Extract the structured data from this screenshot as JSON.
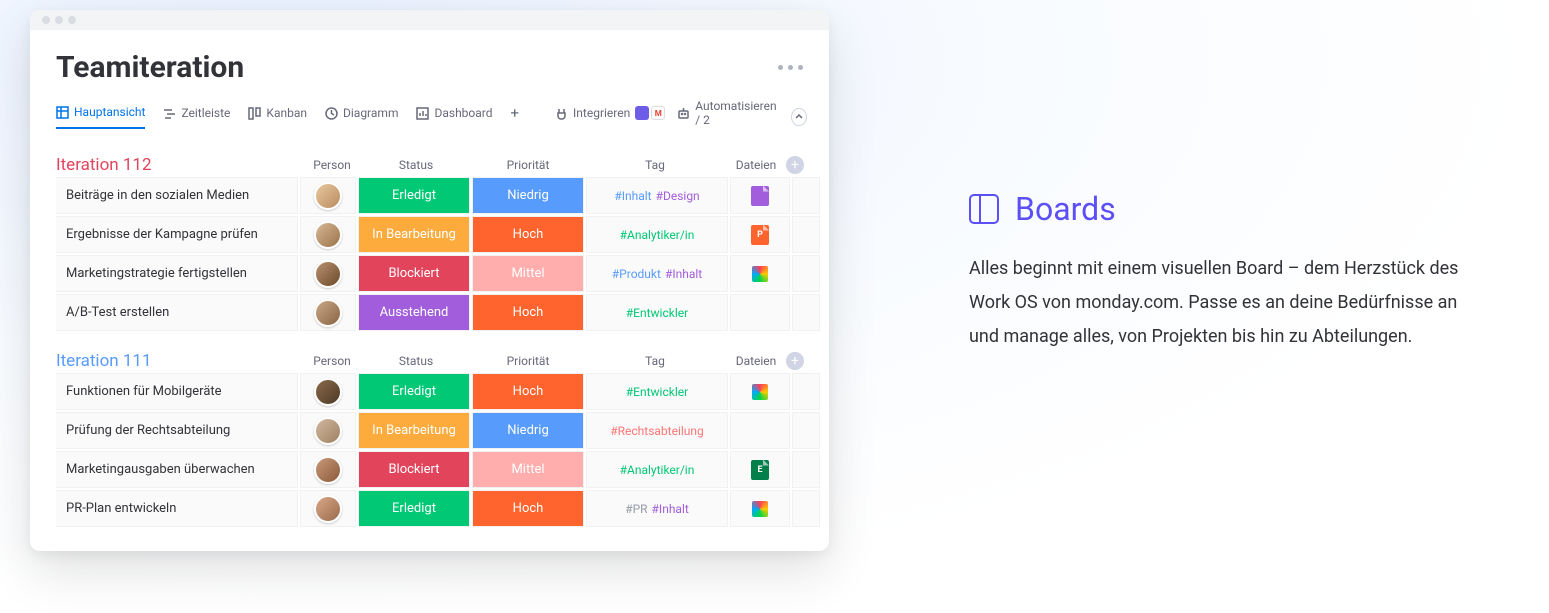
{
  "board": {
    "title": "Teamiteration",
    "tabs": [
      {
        "label": "Hauptansicht"
      },
      {
        "label": "Zeitleiste"
      },
      {
        "label": "Kanban"
      },
      {
        "label": "Diagramm"
      },
      {
        "label": "Dashboard"
      }
    ],
    "tools": {
      "integrate": "Integrieren",
      "automate": "Automatisieren / 2"
    },
    "columns": {
      "person": "Person",
      "status": "Status",
      "priority": "Priorität",
      "tag": "Tag",
      "files": "Dateien"
    },
    "groups": [
      {
        "title": "Iteration 112",
        "rows": [
          {
            "name": "Beiträge in den sozialen Medien",
            "avatar": "linear-gradient(135deg,#e8c8a0,#b98b5e)",
            "status": {
              "label": "Erledigt",
              "bg": "#00c875"
            },
            "priority": {
              "label": "Niedrig",
              "bg": "#579bfc"
            },
            "tags": [
              {
                "t": "#Inhalt",
                "c": "#579bfc"
              },
              {
                "t": "#Design",
                "c": "#a25ddc"
              }
            ],
            "file": {
              "bg": "#a25ddc"
            }
          },
          {
            "name": "Ergebnisse der Kampagne prüfen",
            "avatar": "linear-gradient(135deg,#d8b896,#9a7248)",
            "status": {
              "label": "In Bearbeitung",
              "bg": "#fdab3d"
            },
            "priority": {
              "label": "Hoch",
              "bg": "#ff642e"
            },
            "tags": [
              {
                "t": "#Analytiker/in",
                "c": "#00c875"
              }
            ],
            "file": {
              "bg": "#ff642e",
              "txt": "P"
            }
          },
          {
            "name": "Marketingstrategie fertigstellen",
            "avatar": "linear-gradient(135deg,#b89070,#6d4a2a)",
            "status": {
              "label": "Blockiert",
              "bg": "#e2445c"
            },
            "priority": {
              "label": "Mittel",
              "bg": "#ffadad"
            },
            "tags": [
              {
                "t": "#Produkt",
                "c": "#579bfc"
              },
              {
                "t": "#Inhalt",
                "c": "#a25ddc"
              }
            ],
            "file": {
              "rainbow": true
            }
          },
          {
            "name": "A/B-Test erstellen",
            "avatar": "linear-gradient(135deg,#c8a888,#8a6444)",
            "status": {
              "label": "Ausstehend",
              "bg": "#a25ddc"
            },
            "priority": {
              "label": "Hoch",
              "bg": "#ff642e"
            },
            "tags": [
              {
                "t": "#Entwickler",
                "c": "#00c875"
              }
            ],
            "file": null
          }
        ]
      },
      {
        "title": "Iteration 111",
        "rows": [
          {
            "name": "Funktionen für Mobilgeräte",
            "avatar": "linear-gradient(135deg,#8a6a4a,#4d3a26)",
            "status": {
              "label": "Erledigt",
              "bg": "#00c875"
            },
            "priority": {
              "label": "Hoch",
              "bg": "#ff642e"
            },
            "tags": [
              {
                "t": "#Entwickler",
                "c": "#00c875"
              }
            ],
            "file": {
              "rainbow": true
            }
          },
          {
            "name": "Prüfung der Rechtsabteilung",
            "avatar": "linear-gradient(135deg,#d0b8a0,#a08060)",
            "status": {
              "label": "In Bearbeitung",
              "bg": "#fdab3d"
            },
            "priority": {
              "label": "Niedrig",
              "bg": "#579bfc"
            },
            "tags": [
              {
                "t": "#Rechtsabteilung",
                "c": "#ff7575"
              }
            ],
            "file": null
          },
          {
            "name": "Marketingausgaben überwachen",
            "avatar": "linear-gradient(135deg,#c89878,#8a5a3a)",
            "status": {
              "label": "Blockiert",
              "bg": "#e2445c"
            },
            "priority": {
              "label": "Mittel",
              "bg": "#ffadad"
            },
            "tags": [
              {
                "t": "#Analytiker/in",
                "c": "#00c875"
              }
            ],
            "file": {
              "bg": "#037f4c",
              "txt": "E"
            }
          },
          {
            "name": "PR-Plan entwickeln",
            "avatar": "linear-gradient(135deg,#d8a888,#9a6a4a)",
            "status": {
              "label": "Erledigt",
              "bg": "#00c875"
            },
            "priority": {
              "label": "Hoch",
              "bg": "#ff642e"
            },
            "tags": [
              {
                "t": "#PR",
                "c": "#9699a6"
              },
              {
                "t": "#Inhalt",
                "c": "#a25ddc"
              }
            ],
            "file": {
              "rainbow": true
            }
          }
        ]
      }
    ]
  },
  "prose": {
    "heading": "Boards",
    "body": "Alles beginnt mit einem visuellen Board – dem Herzstück des Work OS von monday.com. Passe es an deine Bedürfnisse an und manage alles, von Projekten bis hin zu Abteilungen."
  }
}
